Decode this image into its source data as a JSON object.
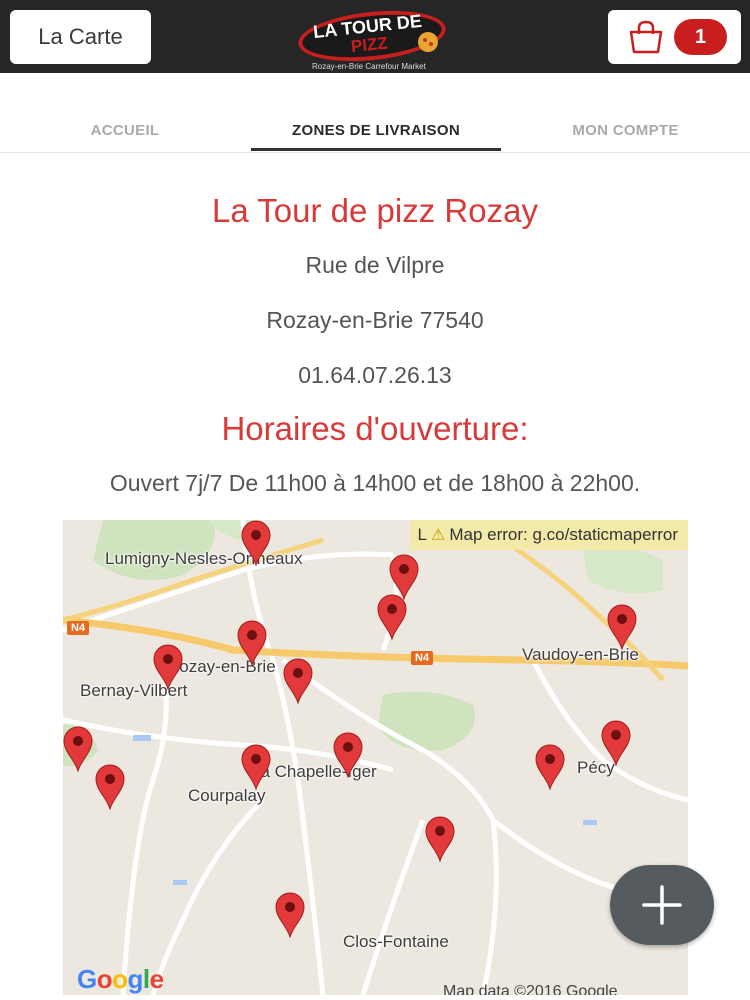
{
  "header": {
    "menu_label": "La Carte",
    "logo_text_top": "LA TOUR DE",
    "logo_text_bottom": "PIZZ",
    "logo_tagline": "Rozay-en-Brie Carrefour Market",
    "cart_count": "1"
  },
  "tabs": [
    {
      "label": "ACCUEIL",
      "active": false
    },
    {
      "label": "ZONES DE LIVRAISON",
      "active": true
    },
    {
      "label": "MON COMPTE",
      "active": false
    }
  ],
  "shop": {
    "name": "La Tour de pizz Rozay",
    "street": "Rue de Vilpre",
    "city": "Rozay-en-Brie 77540",
    "phone": "01.64.07.26.13"
  },
  "hours": {
    "title": "Horaires d'ouverture:",
    "text": "Ouvert 7j/7 De 11h00 à 14h00 et de 18h00 à 22h00."
  },
  "map": {
    "error": "Map error: g.co/staticmaperror",
    "error_prefix": "L",
    "places": [
      "Lumigny-Nesles-Ormeaux",
      "Vaudoy-en-Brie",
      "Rozay-en-Brie",
      "Bernay-Vilbert",
      "La Chapelle-Iger",
      "Courpalay",
      "Pécy",
      "Clos-Fontaine"
    ],
    "road_labels": [
      "N4",
      "N4"
    ],
    "google_label": "Google",
    "credit": "Map data ©2016 Google",
    "pin_count": 16
  },
  "colors": {
    "accent": "#d83a3a",
    "topbar": "#262626",
    "badge": "#c81e1e",
    "pin": "#e2393a"
  }
}
